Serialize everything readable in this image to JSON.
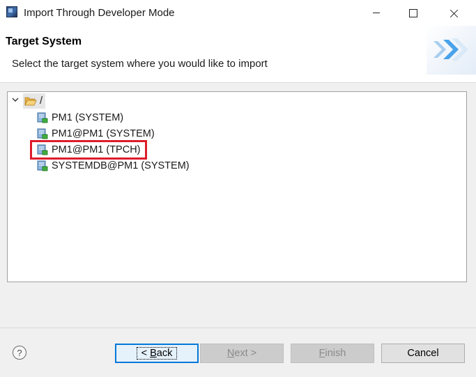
{
  "window": {
    "title": "Import Through Developer Mode"
  },
  "header": {
    "title": "Target System",
    "description": "Select the target system where you would like to import"
  },
  "tree": {
    "root_label": "/",
    "items": [
      {
        "label": "PM1 (SYSTEM)"
      },
      {
        "label": "PM1@PM1 (SYSTEM)"
      },
      {
        "label": "PM1@PM1 (TPCH)",
        "highlighted": true
      },
      {
        "label": "SYSTEMDB@PM1 (SYSTEM)"
      }
    ]
  },
  "buttons": {
    "help_label": "?",
    "back": {
      "mnemonic": "B",
      "rest": "ack",
      "prefix": "< "
    },
    "next": {
      "mnemonic": "N",
      "rest": "ext",
      "suffix": " >"
    },
    "finish": {
      "mnemonic": "F",
      "rest": "inish"
    },
    "cancel": "Cancel"
  },
  "colors": {
    "highlight_border": "#dd1c2b",
    "default_button_border": "#0078d7"
  }
}
